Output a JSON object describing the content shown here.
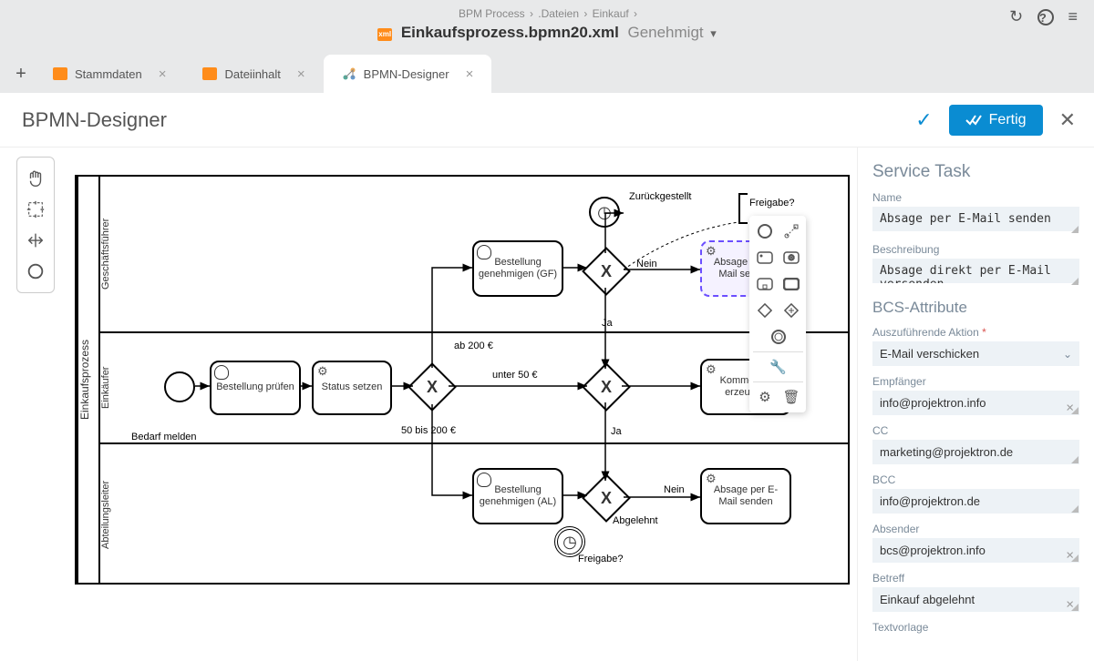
{
  "breadcrumb": [
    "BPM Process",
    ".Dateien",
    "Einkauf"
  ],
  "file": {
    "name": "Einkaufsprozess.bpmn20.xml",
    "status": "Genehmigt"
  },
  "tabs": [
    {
      "label": "Stammdaten"
    },
    {
      "label": "Dateiinhalt"
    },
    {
      "label": "BPMN-Designer"
    }
  ],
  "page_title": "BPMN-Designer",
  "actions": {
    "fertig": "Fertig"
  },
  "pool": {
    "name": "Einkaufsprozess",
    "lanes": [
      {
        "name": "Geschäftsführer"
      },
      {
        "name": "Einkäufer"
      },
      {
        "name": "Abteilungsleiter"
      }
    ]
  },
  "nodes": {
    "prufen": "Bestellung prüfen",
    "status_setzen": "Status setzen",
    "gen_gf": "Bestellung genehmigen (GF)",
    "gen_al": "Bestellung genehmigen (AL)",
    "kommentar": "Kommentar erzeugen",
    "absage1": "Absage per E-Mail senden",
    "absage2": "Absage per E-Mail senden",
    "bedarf": "Bedarf melden"
  },
  "edge_labels": {
    "zuruck": "Zurückgestellt",
    "freigabe1": "Freigabe?",
    "freigabe2": "Freigabe?",
    "nein1": "Nein",
    "nein2": "Nein",
    "ja1": "Ja",
    "ja2": "Ja",
    "ab200": "ab 200 €",
    "unter50": "unter 50 €",
    "range": "50 bis 200 €",
    "abgelehnt": "Abgelehnt"
  },
  "props": {
    "title": "Service Task",
    "name_lbl": "Name",
    "name_val": "Absage per E-Mail senden",
    "desc_lbl": "Beschreibung",
    "desc_val": "Absage direkt per E-Mail versenden",
    "attrs_title": "BCS-Attribute",
    "action_lbl": "Auszuführende Aktion",
    "action_val": "E-Mail verschicken",
    "emp_lbl": "Empfänger",
    "emp_val": "info@projektron.info",
    "cc_lbl": "CC",
    "cc_val": "marketing@projektron.de",
    "bcc_lbl": "BCC",
    "bcc_val": "info@projektron.de",
    "abs_lbl": "Absender",
    "abs_val": "bcs@projektron.info",
    "betreff_lbl": "Betreff",
    "betreff_val": "Einkauf abgelehnt",
    "textv_lbl": "Textvorlage"
  }
}
